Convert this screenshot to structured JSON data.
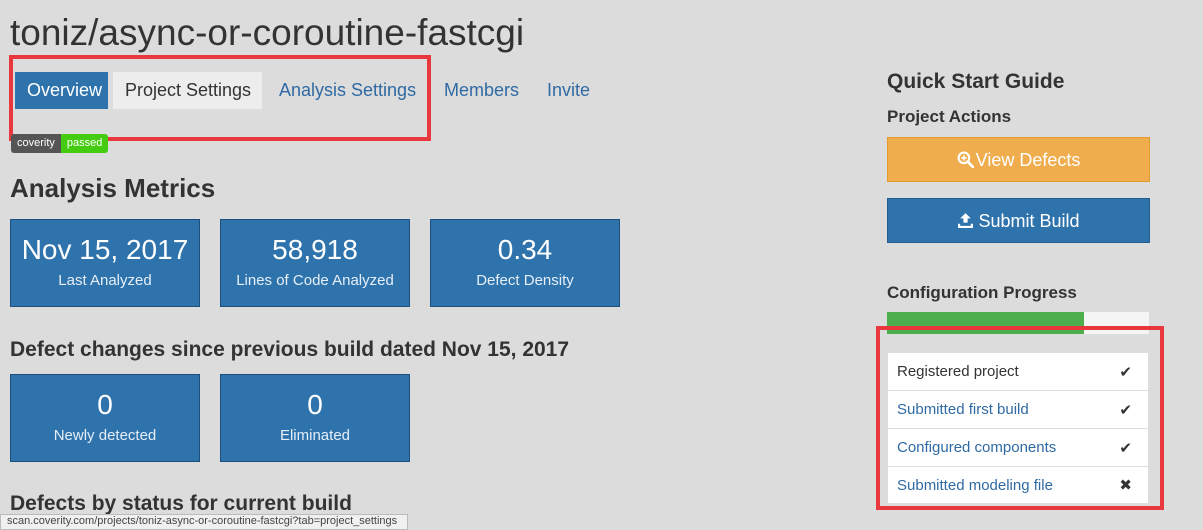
{
  "project_title": "toniz/async-or-coroutine-fastcgi",
  "tabs": [
    {
      "label": "Overview"
    },
    {
      "label": "Project Settings"
    },
    {
      "label": "Analysis Settings"
    },
    {
      "label": "Members"
    },
    {
      "label": "Invite"
    }
  ],
  "badge": {
    "left": "coverity",
    "right": "passed"
  },
  "metrics": {
    "heading": "Analysis Metrics",
    "cards": [
      {
        "value": "Nov 15, 2017",
        "label": "Last Analyzed"
      },
      {
        "value": "58,918",
        "label": "Lines of Code Analyzed"
      },
      {
        "value": "0.34",
        "label": "Defect Density"
      }
    ]
  },
  "defect_changes": {
    "heading": "Defect changes since previous build dated Nov 15, 2017",
    "cards": [
      {
        "value": "0",
        "label": "Newly detected"
      },
      {
        "value": "0",
        "label": "Eliminated"
      }
    ]
  },
  "defects_status_heading": "Defects by status for current build",
  "sidebar": {
    "guide_title": "Quick Start Guide",
    "actions_title": "Project Actions",
    "view_defects_label": "View Defects",
    "submit_build_label": "Submit Build",
    "config_title": "Configuration Progress",
    "progress_fraction": 0.75,
    "checklist": [
      {
        "label": "Registered project",
        "mark": "✔",
        "link": false
      },
      {
        "label": "Submitted first build",
        "mark": "✔",
        "link": true
      },
      {
        "label": "Configured components",
        "mark": "✔",
        "link": true
      },
      {
        "label": "Submitted modeling file",
        "mark": "✖",
        "link": true
      }
    ]
  },
  "status_bar_text": "scan.coverity.com/projects/toniz-async-or-coroutine-fastcgi?tab=project_settings",
  "colors": {
    "accent": "#2f73ad",
    "warning": "#efad4d",
    "success": "#4cae4c",
    "highlight": "#e8383d"
  }
}
